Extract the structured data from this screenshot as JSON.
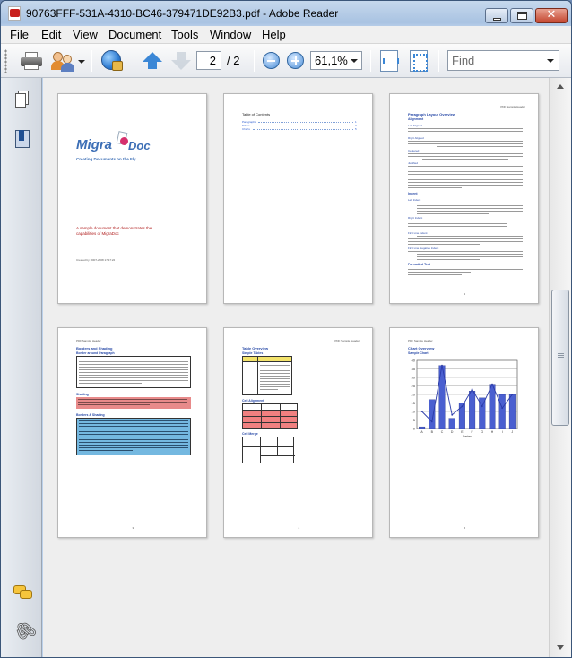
{
  "window": {
    "title": "90763FFF-531A-4310-BC46-379471DE92B3.pdf - Adobe Reader"
  },
  "menu": [
    "File",
    "Edit",
    "View",
    "Document",
    "Tools",
    "Window",
    "Help"
  ],
  "toolbar": {
    "page_current": "2",
    "page_total": "/ 2",
    "zoom": "61,1%",
    "find_placeholder": "Find"
  },
  "pages": {
    "cover": {
      "logo_left": "Migra",
      "logo_right": "Doc",
      "tagline": "Creating Documents on the Fly",
      "description": "A sample document that demonstrates the capabilities of MigraDoc",
      "created": "Created by: 2007-2008 17:17:22"
    },
    "toc": {
      "title": "Table of Contents",
      "entries": [
        "Paragraphs",
        "Tables",
        "Charts"
      ],
      "entry_pages": [
        "1",
        "3",
        "5"
      ]
    },
    "paragraph": {
      "header": "PDF Sample Header",
      "title": "Paragraph Layout Overview",
      "h_alignment": "Alignment",
      "left_aligned": "Left Aligned",
      "right_aligned": "Right Aligned",
      "centered": "Centered",
      "justified": "Justified",
      "indent": "Indent",
      "left_indent": "Left Indent",
      "right_indent": "Right Indent",
      "first_line": "First Line Indent",
      "first_line_neg": "First Line Negative Indent",
      "formatted": "Formatted Text",
      "number": "2"
    },
    "borders": {
      "header": "PDF Sample Header",
      "title": "Borders and Shading",
      "h1": "Border around Paragraph",
      "h2": "Shading",
      "h3": "Borders & Shading",
      "number": "3"
    },
    "tables": {
      "header": "PDF Sample Header",
      "title": "Table Overview",
      "h1": "Simple Tables",
      "h2": "Cell Alignment",
      "h3": "Cell Merge",
      "number": "4"
    },
    "chart": {
      "header": "PDF Sample Header",
      "title": "Chart Overview",
      "subtitle": "Sample Chart",
      "number": "5"
    }
  },
  "chart_data": {
    "type": "bar",
    "categories": [
      "A",
      "B",
      "C",
      "D",
      "E",
      "F",
      "G",
      "H",
      "I",
      "J"
    ],
    "series": [
      {
        "values": [
          1,
          17,
          37,
          6,
          15,
          22,
          18,
          26,
          20,
          20
        ]
      },
      {
        "values": [
          10,
          4,
          37,
          8,
          13,
          23,
          13,
          26,
          12,
          20
        ]
      }
    ],
    "ylim": [
      0,
      40
    ],
    "xlabel": "Series",
    "colors": {
      "bars": "#4a5fd0",
      "line": "#2a3aa8"
    }
  }
}
